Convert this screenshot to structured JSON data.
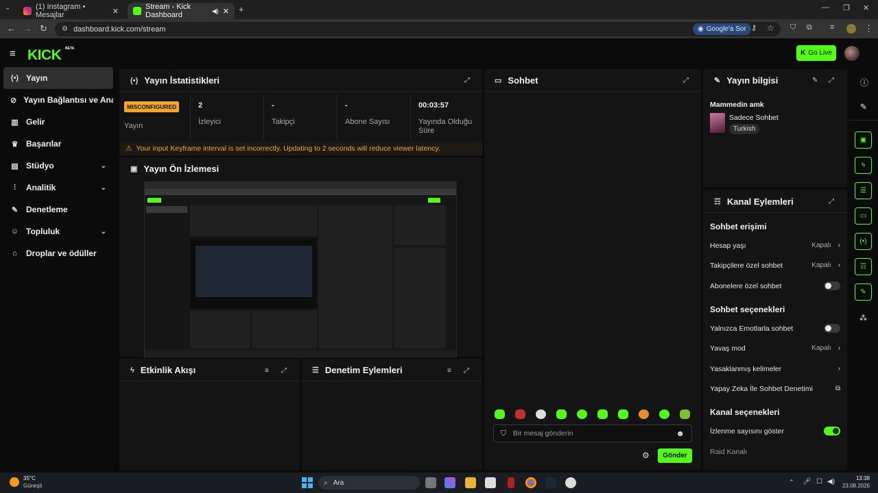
{
  "browser": {
    "tabs": [
      {
        "title": "(1) Instagram • Mesajlar"
      },
      {
        "title": "Stream - Kick Dashboard"
      }
    ],
    "url": "dashboard.kick.com/stream",
    "google_label": "Google'a Sor"
  },
  "header": {
    "logo": "KICK",
    "beta": "BETA",
    "go_live": "Go Live"
  },
  "sidebar": {
    "items": [
      {
        "label": "Yayın",
        "icon": "broadcast-icon",
        "glyph": "(•)"
      },
      {
        "label": "Yayın Bağlantısı ve Anahtarı",
        "icon": "link-icon",
        "glyph": "⊘"
      },
      {
        "label": "Gelir",
        "icon": "chart-icon",
        "glyph": "▥"
      },
      {
        "label": "Başarılar",
        "icon": "trophy-icon",
        "glyph": "♛"
      },
      {
        "label": "Stüdyo",
        "icon": "studio-icon",
        "glyph": "▤"
      },
      {
        "label": "Analitik",
        "icon": "analytics-icon",
        "glyph": "⫶"
      },
      {
        "label": "Denetleme",
        "icon": "wrench-icon",
        "glyph": "✎"
      },
      {
        "label": "Topluluk",
        "icon": "community-icon",
        "glyph": "☺"
      },
      {
        "label": "Droplar ve ödüller",
        "icon": "drops-icon",
        "glyph": "⌂"
      }
    ]
  },
  "stats": {
    "title": "Yayın İstatistikleri",
    "status_badge": "MISCONFIGURED",
    "status_label": "Yayın",
    "viewers_value": "2",
    "viewers_label": "İzleyici",
    "followers_value": "-",
    "followers_label": "Takipçi",
    "subs_value": "-",
    "subs_label": "Abone Sayısı",
    "uptime_value": "00:03:57",
    "uptime_label": "Yayında Olduğu Süre",
    "warning": "Your input Keyframe interval is set incorrectly. Updating to 2 seconds will reduce viewer latency."
  },
  "preview": {
    "title": "Yayın Ön İzlemesi"
  },
  "activity": {
    "title": "Etkinlik Akışı"
  },
  "moderation": {
    "title": "Denetim Eylemleri"
  },
  "chat": {
    "title": "Sohbet",
    "placeholder": "Bir mesaj gönderin",
    "send": "Gönder"
  },
  "stream_info": {
    "title": "Yayın bilgisi",
    "stream_title": "Mammedin amk",
    "category": "Sadece Sohbet",
    "tag": "Turkish"
  },
  "channel_actions": {
    "title": "Kanal Eylemleri",
    "chat_access": "Sohbet erişimi",
    "account_age": "Hesap yaşı",
    "account_age_value": "Kapalı",
    "followers_only": "Takipçilere özel sohbet",
    "followers_only_value": "Kapalı",
    "subs_only": "Abonelere özel sohbet",
    "chat_options": "Sohbet seçenekleri",
    "emote_only": "Yalnızca Emotlarla sohbet",
    "slow_mode": "Yavaş mod",
    "slow_mode_value": "Kapalı",
    "banned_words": "Yasaklanmış kelimeler",
    "ai_moderation": "Yapay Zeka İle Sohbet Denetimi",
    "channel_options": "Kanal seçenekleri",
    "show_viewers": "İzlenme sayısını göster",
    "raid": "Raid Kanalı"
  },
  "taskbar": {
    "weather_temp": "35°C",
    "weather_desc": "Güneşli",
    "search": "Ara",
    "time": "13:38",
    "date": "23.08.2026"
  },
  "colors": {
    "accent": "#53fc18",
    "warning": "#f5a524"
  }
}
